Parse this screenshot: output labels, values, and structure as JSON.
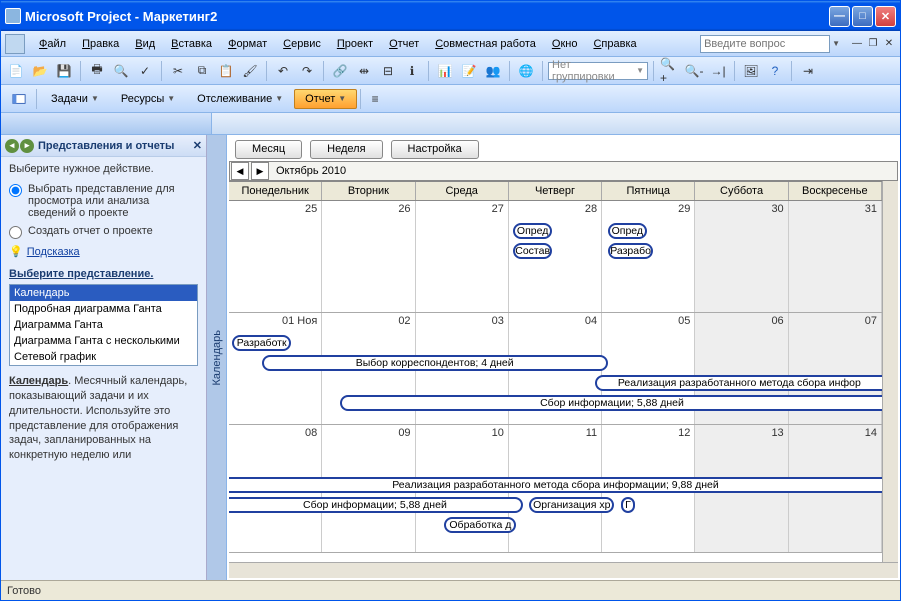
{
  "title": "Microsoft Project - Маркетинг2",
  "menu": [
    "Файл",
    "Правка",
    "Вид",
    "Вставка",
    "Формат",
    "Сервис",
    "Проект",
    "Отчет",
    "Совместная работа",
    "Окно",
    "Справка"
  ],
  "helpPlaceholder": "Введите вопрос",
  "groupFilter": "Нет группировки",
  "viewbar": {
    "tasks": "Задачи",
    "resources": "Ресурсы",
    "tracking": "Отслеживание",
    "report": "Отчет"
  },
  "side": {
    "title": "Представления и отчеты",
    "prompt": "Выберите нужное действие.",
    "opt1": "Выбрать представление для просмотра или анализа сведений о проекте",
    "opt2": "Создать отчет о проекте",
    "hint": "Подсказка",
    "sect": "Выберите представление.",
    "views": [
      "Календарь",
      "Подробная диаграмма Ганта",
      "Диаграмма Ганта",
      "Диаграмма Ганта с несколькими",
      "Сетевой график"
    ],
    "descName": "Календарь",
    "desc": ". Месячный календарь, показывающий задачи и их длительности. Используйте это представление для отображения задач, запланированных на конкретную неделю или"
  },
  "cal": {
    "btnMonth": "Месяц",
    "btnWeek": "Неделя",
    "btnCustom": "Настройка",
    "month": "Октябрь 2010",
    "vtab": "Календарь",
    "days": [
      "Понедельник",
      "Вторник",
      "Среда",
      "Четверг",
      "Пятница",
      "Суббота",
      "Воскресенье"
    ],
    "w1": [
      "25",
      "26",
      "27",
      "28",
      "29",
      "30",
      "31"
    ],
    "w2": [
      "01 Ноя",
      "02",
      "03",
      "04",
      "05",
      "06",
      "07"
    ],
    "w3": [
      "08",
      "09",
      "10",
      "11",
      "12",
      "13",
      "14"
    ]
  },
  "tasks": {
    "opred1": "Опред",
    "opred2": "Опред",
    "sostav": "Состав",
    "razrabo": "Разрабо",
    "razrabotk": "Разработк",
    "vyborkor": "Выбор корреспондентов; 4 дней",
    "realiz1": "Реализация разработанного метода сбора инфор",
    "sbor1": "Сбор информации; 5,88 дней",
    "realiz2": "Реализация разработанного метода сбора информации; 9,88 дней",
    "sbor2": "Сбор информации; 5,88 дней",
    "org": "Организация хр",
    "g": "Г",
    "obr": "Обработка д"
  },
  "status": "Готово"
}
